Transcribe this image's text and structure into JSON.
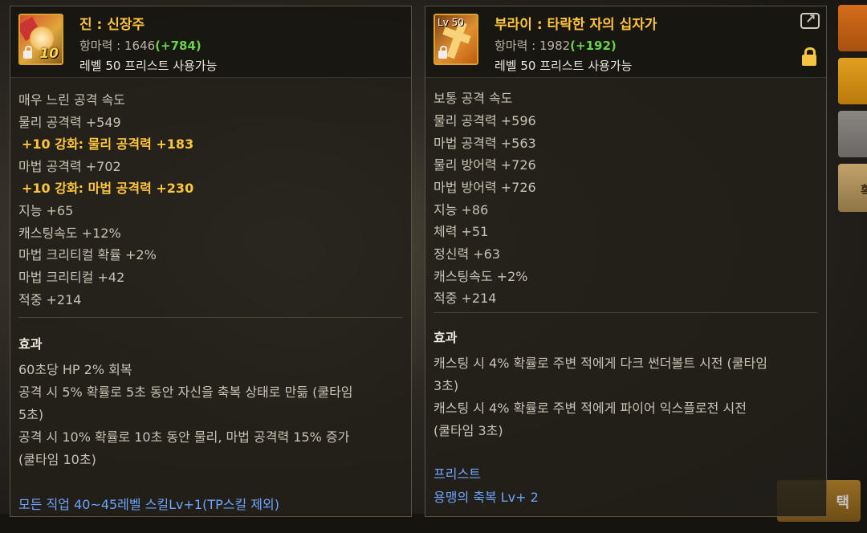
{
  "left_item": {
    "name": "진 : 신장주",
    "power_label": "항마력 : 1646",
    "power_bonus": "(+784)",
    "requirement": "레벨 50 프리스트 사용가능",
    "icon_upgrade": "10",
    "stats": [
      "매우 느린 공격 속도",
      "물리 공격력 +549",
      "+10 강화: 물리 공격력 +183",
      "마법 공격력 +702",
      "+10 강화: 마법 공격력 +230",
      "지능 +65",
      "캐스팅속도 +12%",
      "마법 크리티컬 확률 +2%",
      "마법 크리티컬 +42",
      "적중 +214"
    ],
    "effect_header": "효과",
    "effects": [
      "60초당 HP 2% 회복",
      "공격 시 5% 확률로 5초 동안 자신을 축복 상태로 만듦 (쿨타임",
      "5초)",
      "공격 시 10% 확률로 10초 동안 물리, 마법 공격력 15% 증가",
      "(쿨타임 10초)"
    ],
    "skill_line": "모든 직업 40~45레벨 스킬Lv+1(TP스킬 제외)"
  },
  "right_item": {
    "name": "부라이 : 타락한 자의 십자가",
    "power_label": "항마력 : 1982",
    "power_bonus": "(+192)",
    "requirement": "레벨 50 프리스트 사용가능",
    "icon_level": "Lv 50",
    "stats": [
      "보통 공격 속도",
      "물리 공격력 +596",
      "마법 공격력 +563",
      "물리 방어력 +726",
      "마법 방어력 +726",
      "지능 +86",
      "체력 +51",
      "정신력 +63",
      "캐스팅속도 +2%",
      "적중 +214"
    ],
    "effect_header": "효과",
    "effects": [
      "캐스팅 시 4% 확률로 주변 적에게 다크 썬더볼트 시전 (쿨타임",
      "3초)",
      "캐스팅 시 4% 확률로 주변 적에게 파이어 익스플로전 시전",
      "(쿨타임 3초)"
    ],
    "class_label": "프리스트",
    "skill_line": "용맹의 축복 Lv+ 2"
  },
  "side_buttons": {
    "b4_label": "확"
  },
  "bottom_button": {
    "label": "택"
  },
  "colors": {
    "item_name": "#ffc53d",
    "bonus_green": "#6ad14a",
    "enhance_gold": "#ffc53d",
    "skill_blue": "#6ea3ff"
  }
}
